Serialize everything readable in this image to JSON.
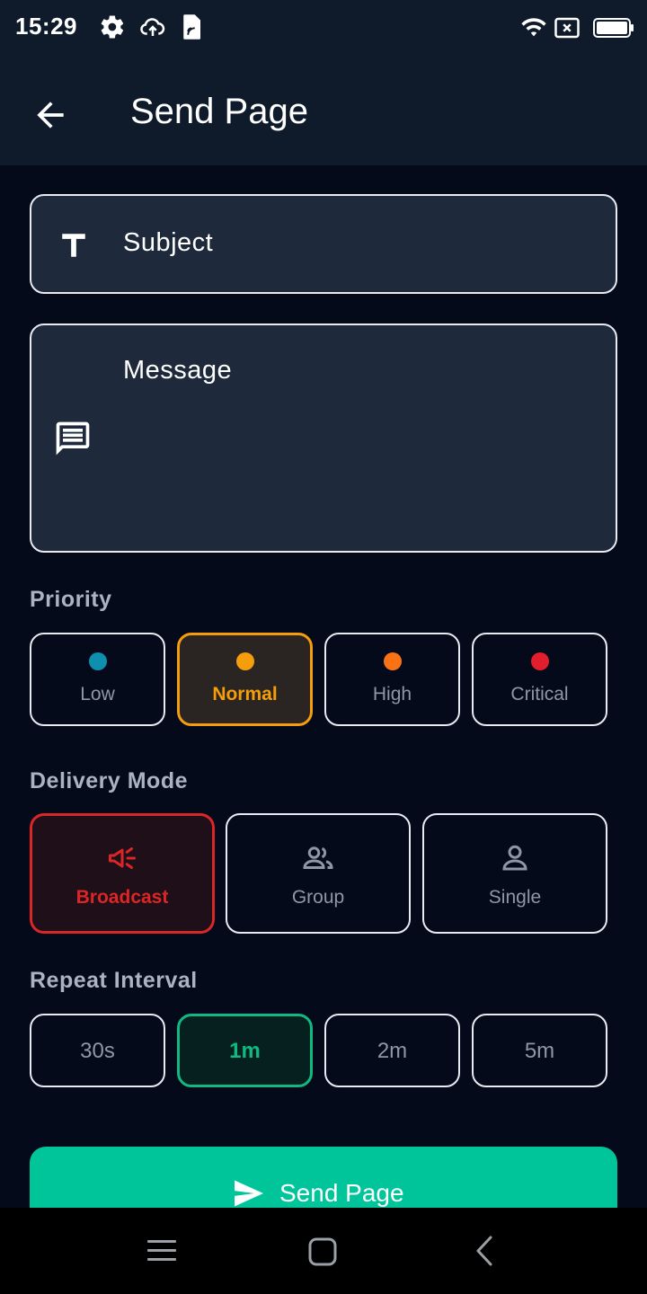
{
  "status_bar": {
    "time": "15:29",
    "left_icons": [
      "gear-icon",
      "cloud-upload-icon",
      "sim-card-icon"
    ],
    "right_icons": [
      "wifi-icon",
      "no-sim-icon",
      "battery-icon"
    ]
  },
  "app_bar": {
    "title": "Send Page",
    "back_icon": "arrow-left-icon"
  },
  "form": {
    "subject_placeholder": "Subject",
    "subject_icon": "text-t-icon",
    "message_placeholder": "Message",
    "message_icon": "message-icon"
  },
  "priority": {
    "label": "Priority",
    "options": [
      {
        "label": "Low",
        "color": "#0e8fb0"
      },
      {
        "label": "Normal",
        "color": "#f59e0b"
      },
      {
        "label": "High",
        "color": "#f97316"
      },
      {
        "label": "Critical",
        "color": "#e11d2e"
      }
    ],
    "selected": "Normal"
  },
  "delivery_mode": {
    "label": "Delivery Mode",
    "options": [
      {
        "label": "Broadcast",
        "icon": "megaphone-icon"
      },
      {
        "label": "Group",
        "icon": "group-icon"
      },
      {
        "label": "Single",
        "icon": "person-icon"
      }
    ],
    "selected": "Broadcast"
  },
  "repeat_interval": {
    "label": "Repeat Interval",
    "options": [
      "30s",
      "1m",
      "2m",
      "5m"
    ],
    "selected": "1m"
  },
  "send_button": {
    "label": "Send Page",
    "icon": "send-icon",
    "color": "#00c49a"
  },
  "nav_bar": {
    "icons": [
      "menu-icon",
      "home-square-icon",
      "back-chevron-icon"
    ]
  }
}
